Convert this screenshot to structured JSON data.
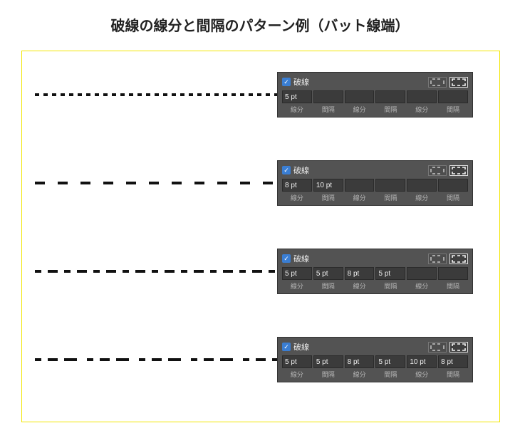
{
  "title": "破線の線分と間隔のパターン例（バット線端）",
  "labels": {
    "dash": "線分",
    "gap": "間隔",
    "dashline": "破線"
  },
  "rows": [
    {
      "pattern": {
        "dash": [
          6
        ],
        "gap": [
          6
        ]
      },
      "panel": {
        "selectedMode": 1,
        "fields": [
          {
            "value": "5 pt",
            "label": "線分"
          },
          {
            "value": "",
            "label": "間隔"
          },
          {
            "value": "",
            "label": "線分"
          },
          {
            "value": "",
            "label": "間隔"
          },
          {
            "value": "",
            "label": "線分"
          },
          {
            "value": "",
            "label": "間隔"
          }
        ]
      }
    },
    {
      "pattern": {
        "dash": [
          14
        ],
        "gap": [
          18
        ]
      },
      "panel": {
        "selectedMode": 1,
        "fields": [
          {
            "value": "8 pt",
            "label": "線分"
          },
          {
            "value": "10 pt",
            "label": "間隔"
          },
          {
            "value": "",
            "label": "線分"
          },
          {
            "value": "",
            "label": "間隔"
          },
          {
            "value": "",
            "label": "線分"
          },
          {
            "value": "",
            "label": "間隔"
          }
        ]
      }
    },
    {
      "pattern": {
        "dash": [
          9,
          14
        ],
        "gap": [
          9,
          9
        ]
      },
      "panel": {
        "selectedMode": 1,
        "fields": [
          {
            "value": "5 pt",
            "label": "線分"
          },
          {
            "value": "5 pt",
            "label": "間隔"
          },
          {
            "value": "8 pt",
            "label": "線分"
          },
          {
            "value": "5 pt",
            "label": "間隔"
          },
          {
            "value": "",
            "label": "線分"
          },
          {
            "value": "",
            "label": "間隔"
          }
        ]
      }
    },
    {
      "pattern": {
        "dash": [
          9,
          14,
          18
        ],
        "gap": [
          9,
          9,
          14
        ]
      },
      "panel": {
        "selectedMode": 1,
        "fields": [
          {
            "value": "5 pt",
            "label": "線分"
          },
          {
            "value": "5 pt",
            "label": "間隔"
          },
          {
            "value": "8 pt",
            "label": "線分"
          },
          {
            "value": "5 pt",
            "label": "間隔"
          },
          {
            "value": "10 pt",
            "label": "線分"
          },
          {
            "value": "8 pt",
            "label": "間隔"
          }
        ]
      }
    }
  ]
}
